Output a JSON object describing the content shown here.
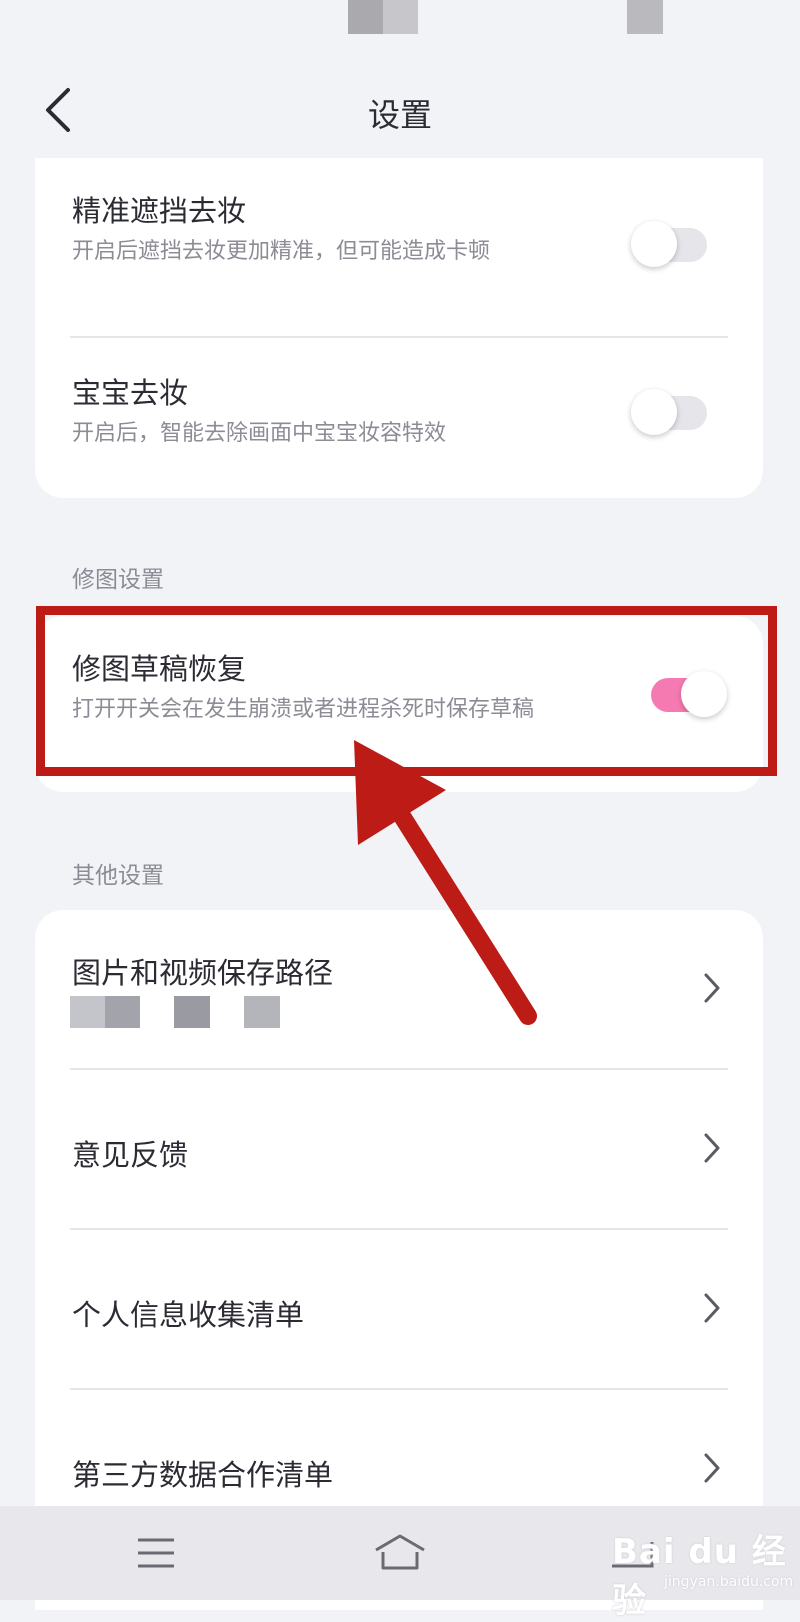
{
  "header": {
    "title": "设置"
  },
  "top_card": {
    "items": [
      {
        "title": "精准遮挡去妆",
        "desc": "开启后遮挡去妆更加精准，但可能造成卡顿",
        "enabled": false
      },
      {
        "title": "宝宝去妆",
        "desc": "开启后，智能去除画面中宝宝妆容特效",
        "enabled": false
      }
    ]
  },
  "edit_section": {
    "label": "修图设置",
    "items": [
      {
        "title": "修图草稿恢复",
        "desc": "打开开关会在发生崩溃或者进程杀死时保存草稿",
        "enabled": true
      }
    ]
  },
  "other_section": {
    "label": "其他设置",
    "items": [
      {
        "title": "图片和视频保存路径"
      },
      {
        "title": "意见反馈"
      },
      {
        "title": "个人信息收集清单"
      },
      {
        "title": "第三方数据合作清单"
      }
    ]
  },
  "colors": {
    "accent": "#f57ab2",
    "highlight": "#bd1b16",
    "background": "#f2f3f7"
  },
  "icons": {
    "back": "chevron-left-icon",
    "row_chevron": "chevron-right-icon",
    "nav_menu": "menu-icon",
    "nav_home": "home-icon",
    "nav_back": "back-icon"
  },
  "watermark": {
    "text": "Bai du 经验",
    "sub": "jingyan.baidu.com"
  }
}
